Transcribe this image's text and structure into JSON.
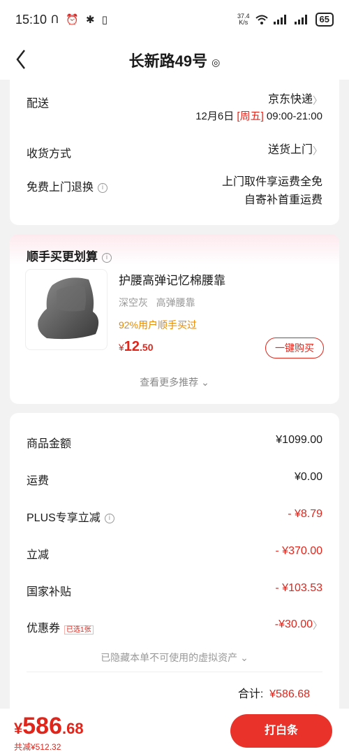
{
  "status": {
    "time": "15:10",
    "left_icons": "ᑎ ⏰ ✱ ▯",
    "net_speed": "37.4",
    "net_unit": "K/s",
    "battery": "65"
  },
  "nav": {
    "title": "长新路49号"
  },
  "delivery": {
    "label": "配送",
    "carrier": "京东快递",
    "date": "12月6日",
    "weekday": "[周五]",
    "time": "09:00-21:00",
    "receive_label": "收货方式",
    "receive_value": "送货上门",
    "return_label": "免费上门退换",
    "return_line1": "上门取件享运费全免",
    "return_line2": "自寄补首重运费"
  },
  "upsell": {
    "title": "顺手买更划算",
    "product_name": "护腰高弹记忆棉腰靠",
    "spec1": "深空灰",
    "spec2": "高弹腰靠",
    "stat": "92%用户顺手买过",
    "price_symbol": "¥",
    "price_int": "12",
    "price_dec": ".50",
    "buy_label": "一键购买",
    "more_label": "查看更多推荐 ⌄"
  },
  "summary": {
    "rows": [
      {
        "label": "商品金额",
        "value": "¥1099.00"
      },
      {
        "label": "运费",
        "value": "¥0.00"
      },
      {
        "label": "PLUS专享立减",
        "value": "- ¥8.79"
      },
      {
        "label": "立减",
        "value": "- ¥370.00"
      },
      {
        "label": "国家补贴",
        "value": "- ¥103.53"
      },
      {
        "label": "优惠券",
        "badge": "已选1张",
        "value": "-¥30.00"
      }
    ],
    "hidden_note": "已隐藏本单不可使用的虚拟资产 ⌄",
    "total_label": "合计:",
    "total_value": "¥586.68"
  },
  "bottom": {
    "symbol": "¥",
    "price_int": "586",
    "price_dec": ".68",
    "saved": "共减¥512.32",
    "pay_label": "打白条"
  },
  "colors": {
    "accent": "#e1251b",
    "orange": "#e68a00"
  }
}
